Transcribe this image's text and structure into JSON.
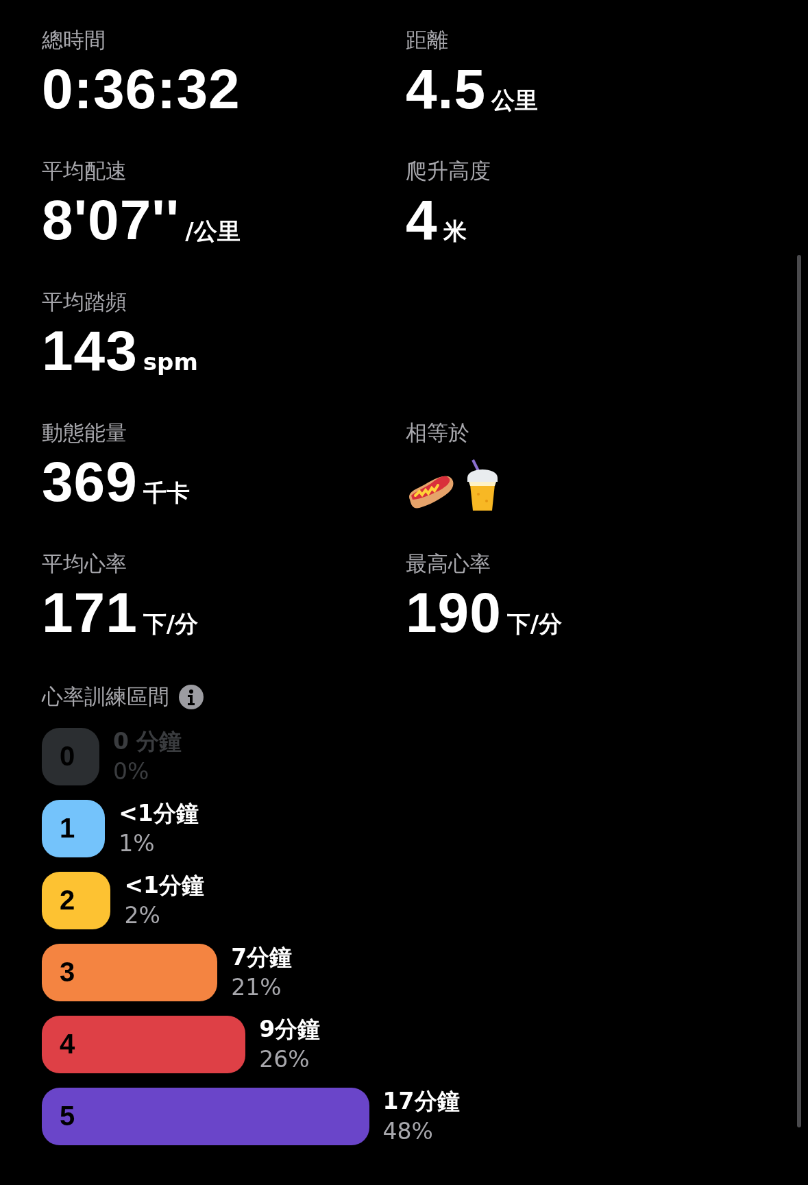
{
  "metric_rows": [
    [
      {
        "kind": "value",
        "label": "總時間",
        "value": "0:36:32"
      },
      {
        "kind": "value",
        "label": "距離",
        "value": "4.5",
        "unit": "公里"
      }
    ],
    [
      {
        "kind": "value",
        "label": "平均配速",
        "value": "8'07''",
        "unit": "/公里"
      },
      {
        "kind": "value",
        "label": "爬升高度",
        "value": "4",
        "unit": "米"
      }
    ],
    [
      {
        "kind": "value",
        "label": "平均踏頻",
        "value": "143",
        "unit": "spm"
      }
    ],
    [
      {
        "kind": "value",
        "label": "動態能量",
        "value": "369",
        "unit": "千卡"
      },
      {
        "kind": "emoji",
        "label": "相等於"
      }
    ],
    [
      {
        "kind": "value",
        "label": "平均心率",
        "value": "171",
        "unit": "下/分"
      },
      {
        "kind": "value",
        "label": "最高心率",
        "value": "190",
        "unit": "下/分"
      }
    ]
  ],
  "zones_title": "心率訓練區間",
  "zones": [
    {
      "number": "0",
      "time": "0 分鐘",
      "percent": "0%",
      "level": 0,
      "color": "#2b2e31",
      "dimmed": true
    },
    {
      "number": "1",
      "time": "<1分鐘",
      "percent": "1%",
      "level": 0.01,
      "color": "#74c3fb",
      "dimmed": false
    },
    {
      "number": "2",
      "time": "<1分鐘",
      "percent": "2%",
      "level": 0.02,
      "color": "#fdc232",
      "dimmed": false
    },
    {
      "number": "3",
      "time": "7分鐘",
      "percent": "21%",
      "level": 0.21,
      "color": "#f48441",
      "dimmed": false
    },
    {
      "number": "4",
      "time": "9分鐘",
      "percent": "26%",
      "level": 0.26,
      "color": "#de4046",
      "dimmed": false
    },
    {
      "number": "5",
      "time": "17分鐘",
      "percent": "48%",
      "level": 0.48,
      "color": "#6a45c9",
      "dimmed": false
    }
  ]
}
